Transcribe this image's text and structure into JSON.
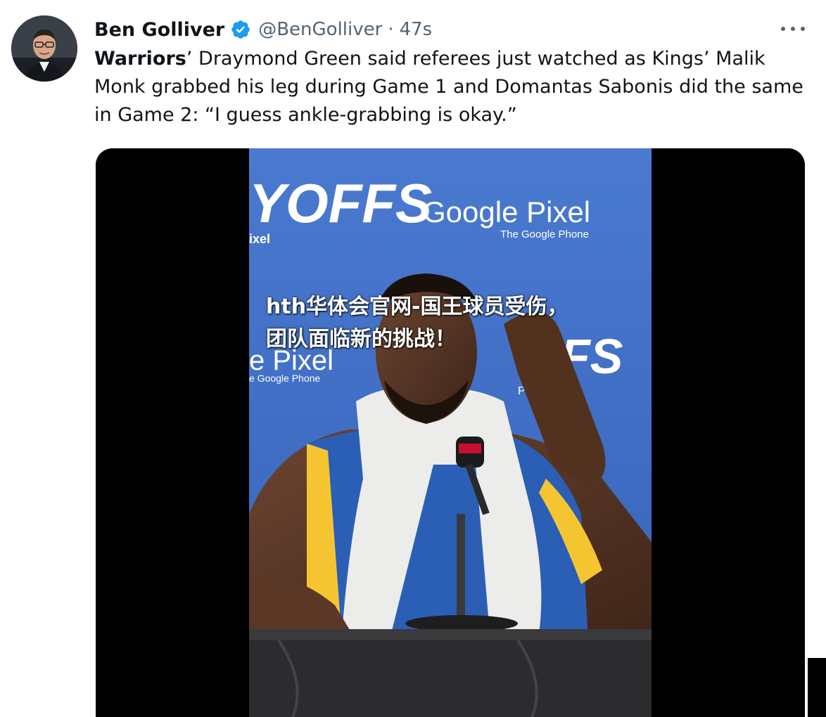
{
  "tweet": {
    "author": {
      "display_name": "Ben Golliver",
      "handle": "@BenGolliver",
      "verified": true,
      "avatar_icon": "profile-photo"
    },
    "separator": "·",
    "timestamp": "47s",
    "more_icon": "more-horizontal-icon",
    "text": {
      "bold_lead": "Warriors",
      "body": "’ Draymond Green said referees just watched as Kings’ Malik Monk grabbed his leg during Game 1 and Domantas Sabonis did the same in Game 2: “I guess ankle-grabbing is okay.”"
    },
    "media": {
      "type": "video-frame",
      "backdrop_text_1": "YOFFS",
      "backdrop_text_2": "ixel",
      "backdrop_brand": "Google Pixel",
      "backdrop_brand_sub": "The Google Phone",
      "backdrop_text_3": "e Pixel",
      "backdrop_text_4": "e Google Phone",
      "backdrop_text_5": "FS",
      "backdrop_text_6": "P"
    },
    "overlay_title": "hth华体会官网-国王球员受伤，团队面临新的挑战！"
  },
  "colors": {
    "text_primary": "#0f1419",
    "text_secondary": "#536471",
    "verified_blue": "#1d9bf0",
    "backdrop_blue": "#3e6fc9"
  }
}
